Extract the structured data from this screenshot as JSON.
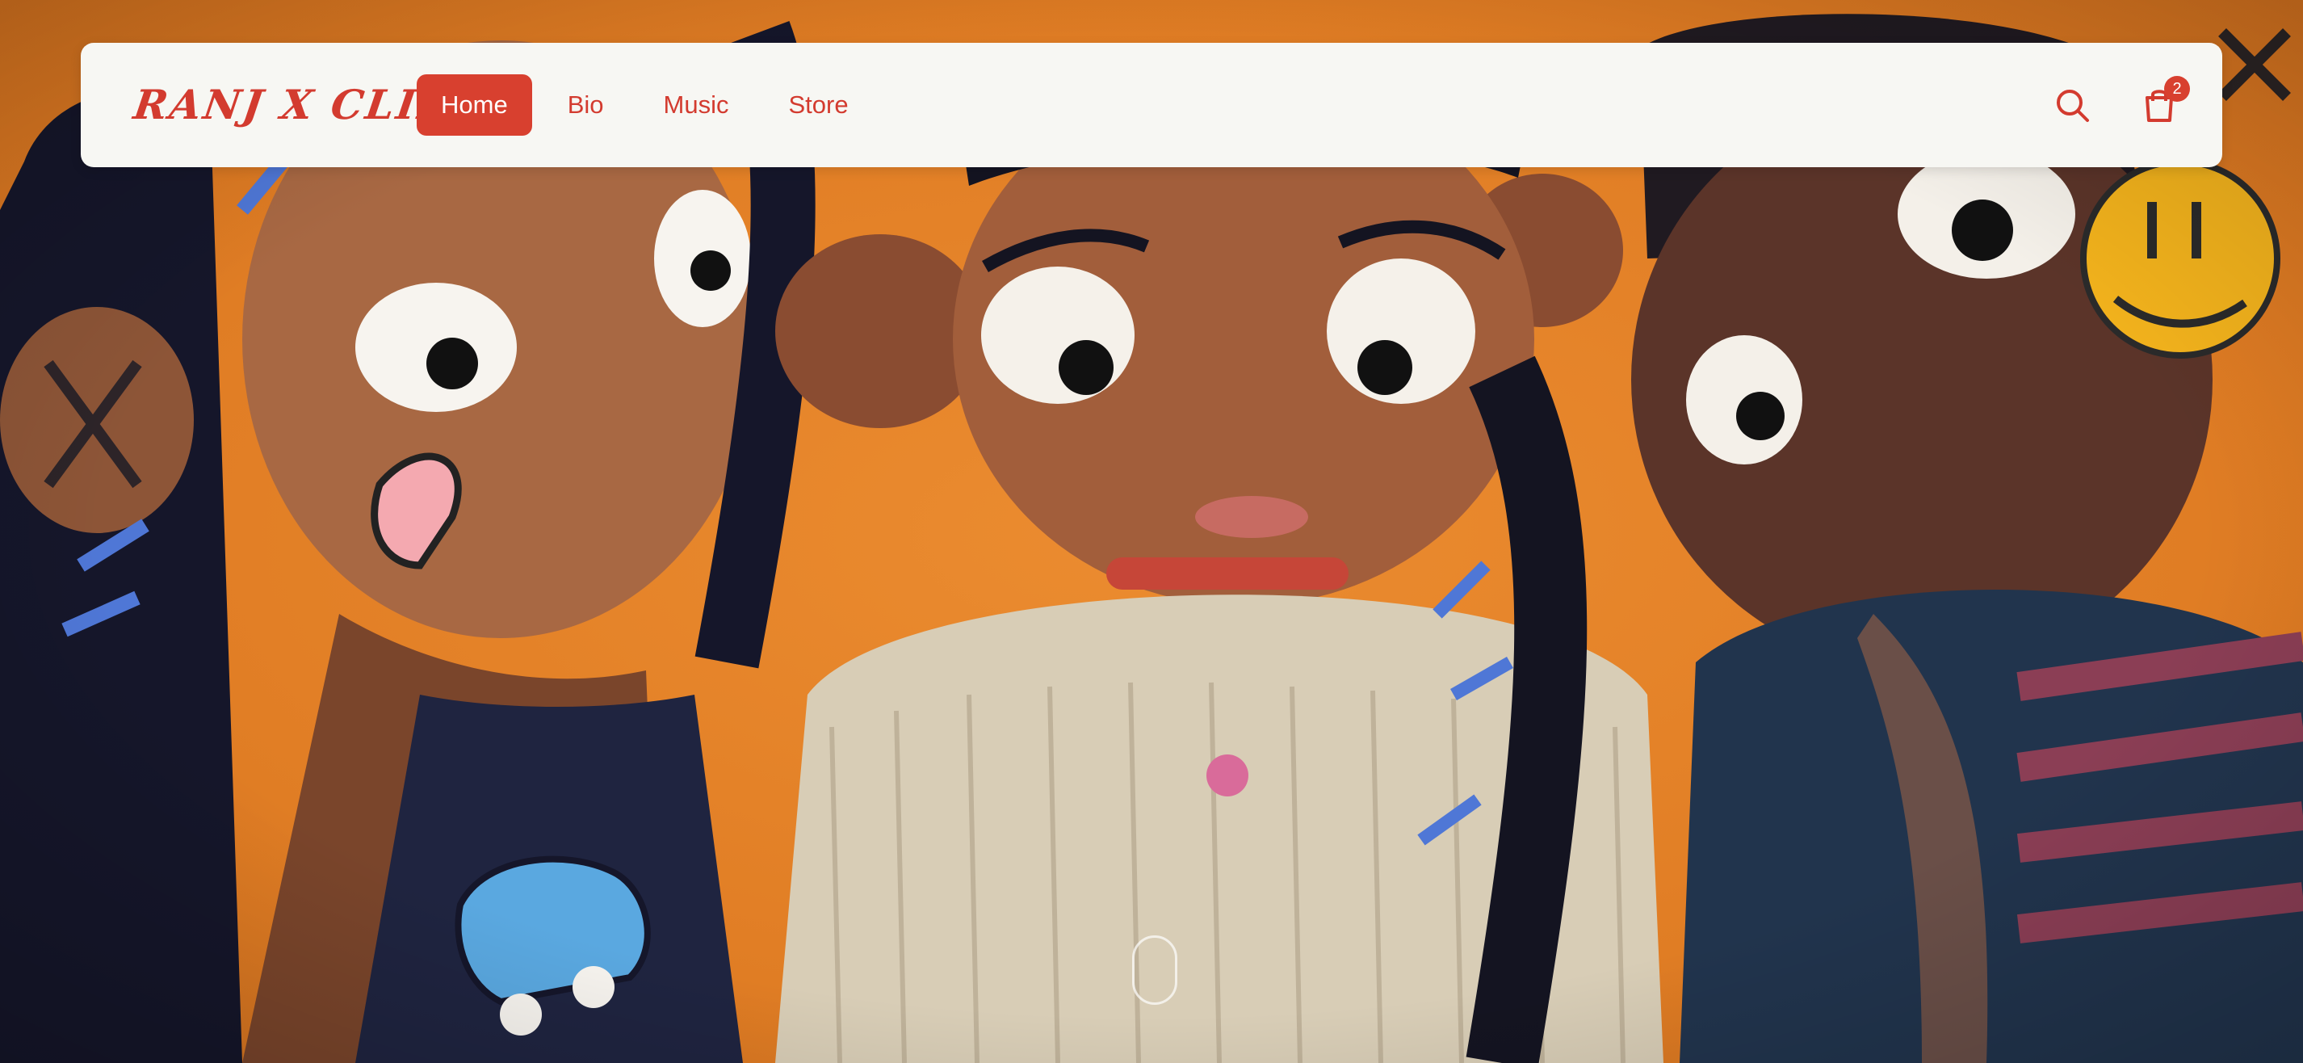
{
  "brand": {
    "logo_text": "RANJ X CLIFR"
  },
  "nav": {
    "items": [
      {
        "label": "Home",
        "active": true
      },
      {
        "label": "Bio",
        "active": false
      },
      {
        "label": "Music",
        "active": false
      },
      {
        "label": "Store",
        "active": false
      }
    ]
  },
  "actions": {
    "search_icon": "search-icon",
    "cart_icon": "shopping-bag-icon",
    "cart_count": "2"
  },
  "hero": {
    "image": "claymation-characters-hero",
    "scroll_indicator_icon": "scroll-mouse-icon"
  },
  "colors": {
    "accent": "#d8402f",
    "nav_bg": "#f7f7f3",
    "hero_bg": "#e1822a"
  }
}
